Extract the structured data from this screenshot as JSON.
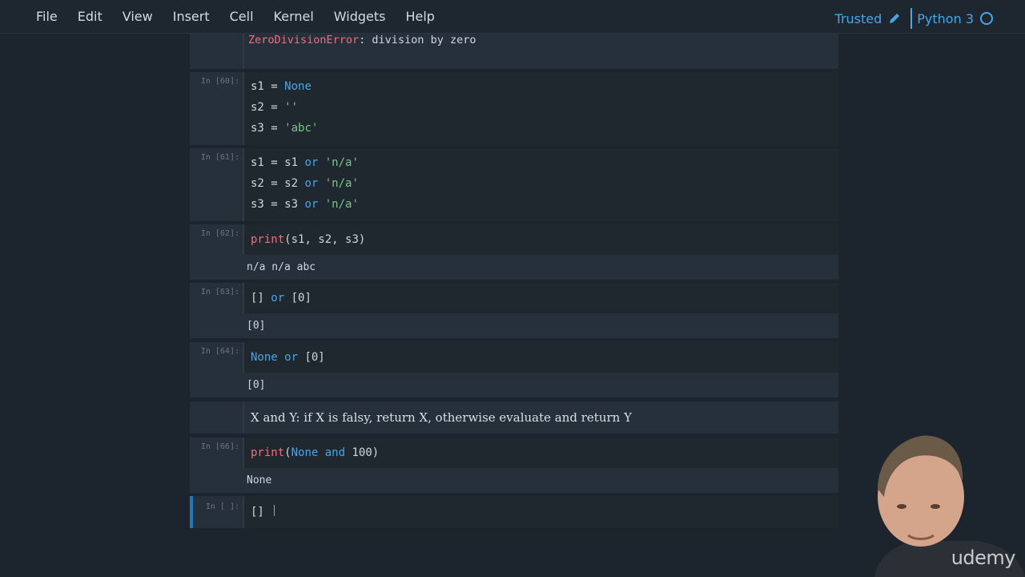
{
  "menu": {
    "items": [
      "File",
      "Edit",
      "View",
      "Insert",
      "Cell",
      "Kernel",
      "Widgets",
      "Help"
    ],
    "trusted": "Trusted",
    "kernel": "Python 3"
  },
  "cells": {
    "c0": {
      "error_name": "ZeroDivisionError",
      "error_msg": ": division by zero"
    },
    "c60": {
      "prompt": "In [60]:",
      "l1a": "s1 = ",
      "l1b": "None",
      "l2a": "s2 = ",
      "l2b": "''",
      "l3a": "s3 = ",
      "l3b": "'abc'"
    },
    "c61": {
      "prompt": "In [61]:",
      "l1a": "s1 = s1 ",
      "l1b": "or",
      "l1c": " ",
      "l1d": "'n/a'",
      "l2a": "s2 = s2 ",
      "l2b": "or",
      "l2c": " ",
      "l2d": "'n/a'",
      "l3a": "s3 = s3 ",
      "l3b": "or",
      "l3c": " ",
      "l3d": "'n/a'"
    },
    "c62": {
      "prompt": "In [62]:",
      "fn": "print",
      "args": "(s1, s2, s3)",
      "output": "n/a n/a abc"
    },
    "c63": {
      "prompt": "In [63]:",
      "a": "[] ",
      "b": "or",
      "c": " [0]",
      "output": "[0]"
    },
    "c64": {
      "prompt": "In [64]:",
      "a": "None",
      "b": " ",
      "c": "or",
      "d": " [0]",
      "output": "[0]"
    },
    "md": {
      "text": "X and Y: if X is falsy, return X, otherwise evaluate and return Y"
    },
    "c66": {
      "prompt": "In [66]:",
      "fn": "print",
      "p1": "(",
      "a": "None",
      "b": " ",
      "c": "and",
      "d": " 100",
      "p2": ")",
      "output": "None"
    },
    "cnew": {
      "prompt": "In [ ]:",
      "code": "[]"
    }
  },
  "watermark": "udemy"
}
